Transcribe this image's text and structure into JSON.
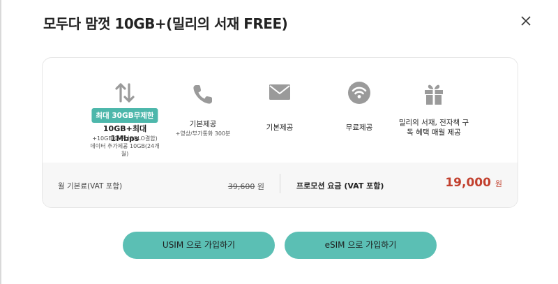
{
  "modal": {
    "title": "모두다 맘껏 10GB+(밀리의 서재 FREE)",
    "close_icon": "close-icon"
  },
  "features": [
    {
      "icon": "data-arrows-icon",
      "badge": "최대 30GB무제한",
      "main": "10GB+최대1Mbps",
      "sub1": "+10GB(아무나SOLO결합) +",
      "sub2": "데이터 추가제공 10GB(24개",
      "sub3": "월)"
    },
    {
      "icon": "phone-icon",
      "main": "기본제공",
      "sub1": "+영상/부가통화 300분"
    },
    {
      "icon": "envelope-icon",
      "main": "기본제공"
    },
    {
      "icon": "wifi-icon",
      "main": "무료제공"
    },
    {
      "icon": "gift-icon",
      "main1": "밀리의 서재, 전자책 구",
      "main2": "독 혜택 매월 제공"
    }
  ],
  "pricing": {
    "monthly_label": "월 기본료(VAT 포함)",
    "original_price": "39,600",
    "original_unit": "원",
    "promo_label": "프로모션 요금 (VAT 포함)",
    "promo_price": "19,000",
    "promo_unit": "원"
  },
  "buttons": {
    "usim": "USIM 으로 가입하기",
    "esim": "eSIM 으로 가입하기"
  },
  "colors": {
    "accent": "#5bbfb4",
    "badge": "#4db7ab",
    "price": "#c2402e",
    "icon_gray": "#9a9a9a"
  }
}
